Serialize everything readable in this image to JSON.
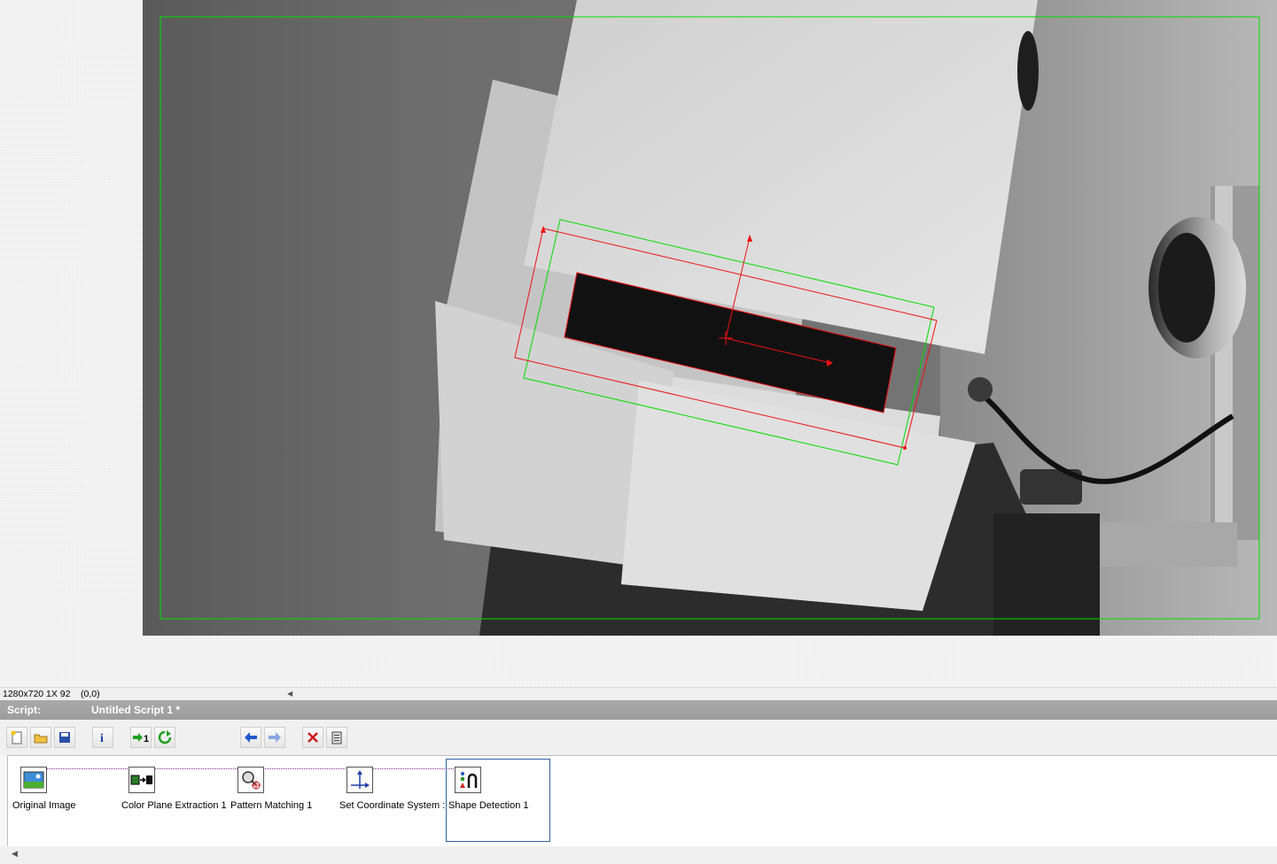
{
  "status": {
    "image_info": "1280x720 1X 92",
    "coordinates": "(0,0)"
  },
  "script": {
    "label": "Script:",
    "name": "Untitled Script 1 *"
  },
  "toolbar": {
    "buttons": [
      "new-script-icon",
      "open-script-icon",
      "save-script-icon",
      "info-icon",
      "run-once-icon",
      "run-continuous-icon",
      "back-icon",
      "forward-icon",
      "delete-step-icon",
      "clipboard-icon"
    ]
  },
  "steps": [
    {
      "label": "Original Image",
      "icon": "original-image-icon"
    },
    {
      "label": "Color Plane Extraction 1",
      "icon": "color-plane-extraction-icon"
    },
    {
      "label": "Pattern Matching 1",
      "icon": "pattern-matching-icon"
    },
    {
      "label": "Set Coordinate System :",
      "icon": "set-coordinate-system-icon"
    },
    {
      "label": "Shape Detection 1",
      "icon": "shape-detection-icon",
      "selected": true
    }
  ],
  "colors": {
    "roi": "#00dd00",
    "match": "#ee1111",
    "selection": "#2f5fa0",
    "header": "#a3a3a3"
  }
}
